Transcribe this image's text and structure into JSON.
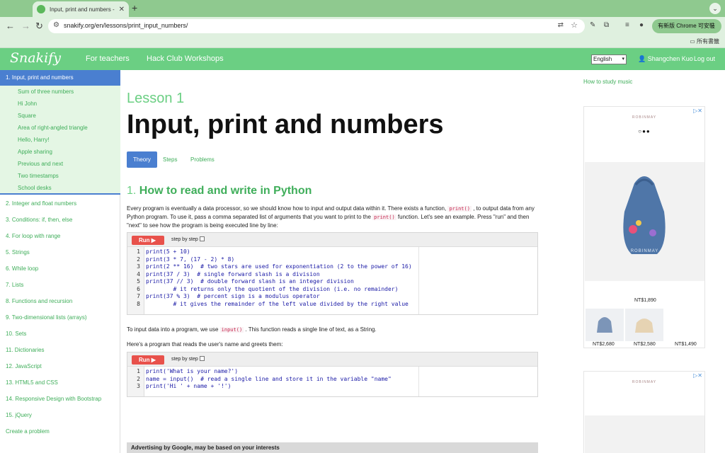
{
  "browser": {
    "tab_title": "Input, print and numbers - Le",
    "url": "snakify.org/en/lessons/print_input_numbers/",
    "update_label": "有新版 Chrome 可安裝",
    "bookmarks_folder": "所有書籤"
  },
  "site": {
    "logo": "Snakify",
    "nav": [
      "For teachers",
      "Hack Club Workshops"
    ],
    "language": "English",
    "user": "Shangchen Kuo",
    "logout": "Log out"
  },
  "sidebar": {
    "active": "1. Input, print and numbers",
    "subitems": [
      "Sum of three numbers",
      "Hi John",
      "Square",
      "Area of right-angled triangle",
      "Hello, Harry!",
      "Apple sharing",
      "Previous and next",
      "Two timestamps",
      "School desks"
    ],
    "items": [
      "2. Integer and float numbers",
      "3. Conditions: if, then, else",
      "4. For loop with range",
      "5. Strings",
      "6. While loop",
      "7. Lists",
      "8. Functions and recursion",
      "9. Two-dimensional lists (arrays)",
      "10. Sets",
      "11. Dictionaries",
      "12. JavaScript",
      "13. HTML5 and CSS",
      "14. Responsive Design with Bootstrap",
      "15. jQuery",
      "Create a problem"
    ]
  },
  "main": {
    "lesson_label": "Lesson 1",
    "title": "Input, print and numbers",
    "tabs": [
      "Theory",
      "Steps",
      "Problems"
    ],
    "section_number": "1.",
    "section_title": "How to read and write in Python",
    "para1": {
      "a": "Every program is eventually a data processor, so we should know how to input and output data within it. There exists a function,",
      "code1": "print()",
      "b": ", to output data from any Python program. To use it, pass a comma separated list of arguments that you want to print to the",
      "code2": "print()",
      "c": "function. Let's see an example. Press \"run\" and then \"next\" to see how the program is being executed line by line:"
    },
    "para2": {
      "a": "To input data into a program, we use",
      "code": "input()",
      "b": ". This function reads a single line of text, as a String."
    },
    "para3": "Here's a program that reads the user's name and greets them:",
    "run_label": "Run ▶",
    "step_label": "step by step",
    "code1": [
      "print(5 + 10)",
      "print(3 * 7, (17 - 2) * 8)",
      "print(2 ** 16)  # two stars are used for exponentiation (2 to the power of 16)",
      "print(37 / 3)  # single forward slash is a division",
      "print(37 // 3)  # double forward slash is an integer division",
      "        # it returns only the quotient of the division (i.e. no remainder)",
      "print(37 % 3)  # percent sign is a modulus operator",
      "        # it gives the remainder of the left value divided by the right value"
    ],
    "code2": [
      "print('What is your name?')",
      "name = input()  # read a single line and store it in the variable \"name\"",
      "print('Hi ' + name + '!')"
    ],
    "ad_bar": "Advertising by Google, may be based on your interests"
  },
  "right": {
    "how_to": "How to study music",
    "ad1": {
      "brand": "ROBINMAY",
      "bag_text": "ROBINMAY",
      "price_main": "NT$1,890",
      "prices": [
        "NT$2,680",
        "NT$2,580",
        "NT$1,490"
      ]
    },
    "ad2": {
      "brand": "ROBINMAY"
    },
    "colors": {
      "accent": "#6bcf83",
      "active": "#4a7fd0",
      "run": "#e8514b"
    }
  }
}
